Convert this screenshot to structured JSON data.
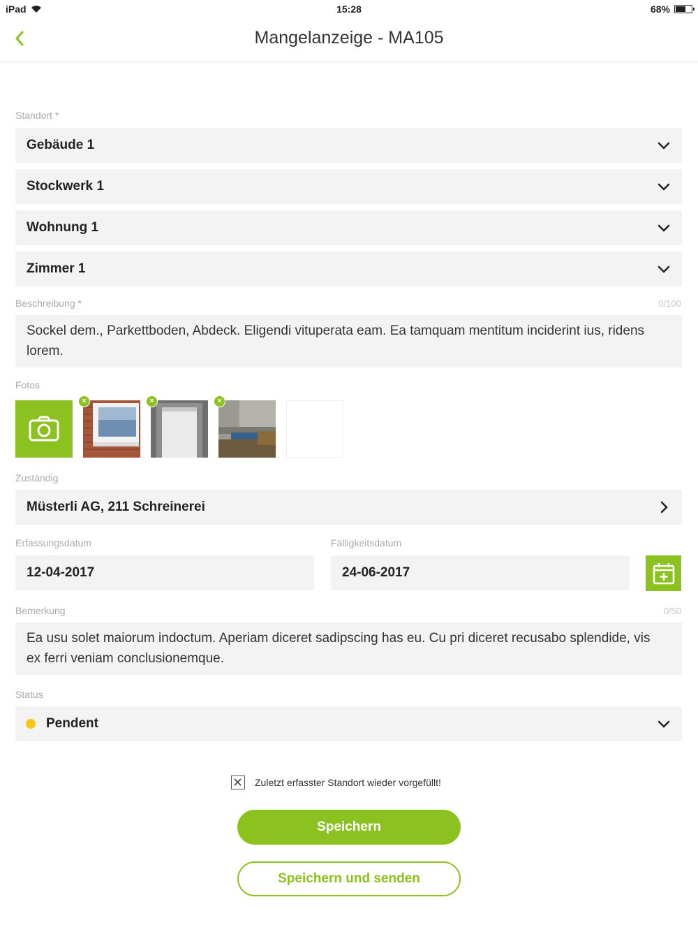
{
  "status_bar": {
    "device": "iPad",
    "time": "15:28",
    "battery": "68%",
    "battery_level": 0.68
  },
  "nav": {
    "title": "Mangelanzeige - MA105",
    "back_icon": "chevron-left-icon"
  },
  "standort": {
    "label": "Standort *",
    "fields": [
      "Gebäude 1",
      "Stockwerk 1",
      "Wohnung 1",
      "Zimmer 1"
    ]
  },
  "beschreibung": {
    "label": "Beschreibung *",
    "counter": "0/100",
    "value": "Sockel dem., Parkettboden, Abdeck. Eligendi vituperata eam. Ea tamquam mentitum inciderint ius, ridens lorem."
  },
  "fotos": {
    "label": "Fotos",
    "camera_icon": "camera-icon"
  },
  "zustaendig": {
    "label": "Zuständig",
    "value": "Müsterli AG, 211 Schreinerei"
  },
  "erfassungsdatum": {
    "label": "Erfassungsdatum",
    "value": "12-04-2017"
  },
  "faelligkeitsdatum": {
    "label": "Fälligkeitsdatum",
    "value": "24-06-2017"
  },
  "bemerkung": {
    "label": "Bemerkung",
    "counter": "0/50",
    "value": "Ea usu solet maiorum indoctum. Aperiam diceret sadipscing has eu. Cu pri diceret recusabo splendide, vis ex ferri veniam conclusionemque."
  },
  "status": {
    "label": "Status",
    "value": "Pendent",
    "dot_color": "#f5c518"
  },
  "checkbox": {
    "label": "Zuletzt erfasster Standort wieder vorgefüllt!"
  },
  "buttons": {
    "save": "Speichern",
    "save_send": "Speichern und senden"
  },
  "colors": {
    "accent": "#8cc21f",
    "field_bg": "#f3f3f3"
  }
}
